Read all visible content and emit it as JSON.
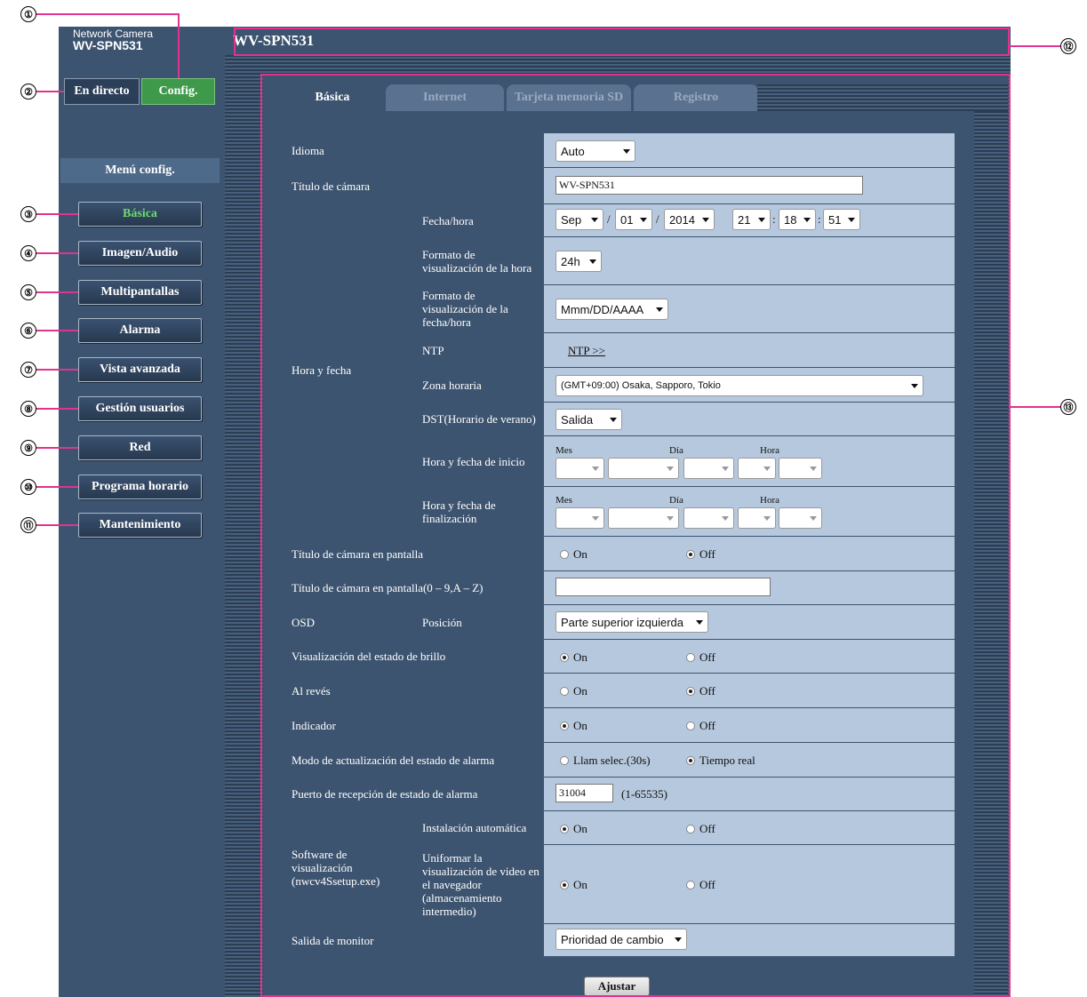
{
  "camera": {
    "label": "Network Camera",
    "model": "WV-SPN531"
  },
  "top_buttons": {
    "live": "En directo",
    "config": "Config."
  },
  "header": {
    "title": "WV-SPN531"
  },
  "menu": {
    "title": "Menú config.",
    "items": [
      "Básica",
      "Imagen/Audio",
      "Multipantallas",
      "Alarma",
      "Vista avanzada",
      "Gestión usuarios",
      "Red",
      "Programa horario",
      "Mantenimiento"
    ]
  },
  "tabs": [
    "Básica",
    "Internet",
    "Tarjeta memoria SD",
    "Registro"
  ],
  "form": {
    "idioma": {
      "label": "Idioma",
      "value": "Auto"
    },
    "titulo_camara": {
      "label": "Título de cámara",
      "value": "WV-SPN531"
    },
    "hora_fecha": {
      "label": "Hora y fecha",
      "fecha_hora": {
        "label": "Fecha/hora",
        "month": "Sep",
        "day": "01",
        "year": "2014",
        "hour": "21",
        "minute": "18",
        "second": "51",
        "sep_date": "/",
        "sep_time": ":"
      },
      "formato_hora": {
        "label": "Formato de visualización de la hora",
        "value": "24h"
      },
      "formato_fecha": {
        "label": "Formato de visualización de la fecha/hora",
        "value": "Mmm/DD/AAAA"
      },
      "ntp": {
        "label": "NTP",
        "link": "NTP >>"
      },
      "zona": {
        "label": "Zona horaria",
        "value": "(GMT+09:00) Osaka, Sapporo, Tokio"
      },
      "dst": {
        "label": "DST(Horario de verano)",
        "value": "Salida"
      },
      "inicio": {
        "label": "Hora y fecha de inicio"
      },
      "fin": {
        "label": "Hora y fecha de finalización"
      },
      "col_mes": "Mes",
      "col_dia": "Día",
      "col_hora": "Hora"
    },
    "titulo_pantalla": {
      "label": "Título de cámara en pantalla",
      "on": "On",
      "off": "Off",
      "selected": "Off"
    },
    "titulo_pantalla_09": {
      "label": "Título de cámara en pantalla(0 – 9,A – Z)",
      "value": ""
    },
    "osd": {
      "label": "OSD",
      "sub": "Posición",
      "value": "Parte superior izquierda"
    },
    "brillo": {
      "label": "Visualización del estado de brillo",
      "on": "On",
      "off": "Off",
      "selected": "On"
    },
    "alreves": {
      "label": "Al revés",
      "on": "On",
      "off": "Off",
      "selected": "Off"
    },
    "indicador": {
      "label": "Indicador",
      "on": "On",
      "off": "Off",
      "selected": "On"
    },
    "modo_alarma": {
      "label": "Modo de actualización del estado de alarma",
      "opt1": "Llam selec.(30s)",
      "opt2": "Tiempo real",
      "selected": "Tiempo real"
    },
    "puerto_alarma": {
      "label": "Puerto de recepción de estado de alarma",
      "value": "31004",
      "range": "(1-65535)"
    },
    "software": {
      "label": "Software de visualización (nwcv4Ssetup.exe)",
      "instalacion": {
        "label": "Instalación automática",
        "on": "On",
        "off": "Off",
        "selected": "On"
      },
      "uniformar": {
        "label": "Uniformar la visualización de video en el navegador (almacenamiento intermedio)",
        "on": "On",
        "off": "Off",
        "selected": "On"
      }
    },
    "salida_monitor": {
      "label": "Salida de monitor",
      "value": "Prioridad de cambio"
    }
  },
  "buttons": {
    "ajustar": "Ajustar"
  },
  "callouts": [
    "①",
    "②",
    "③",
    "④",
    "⑤",
    "⑥",
    "⑦",
    "⑧",
    "⑨",
    "⑩",
    "⑪",
    "⑫",
    "⑬"
  ],
  "colors": {
    "nav_bg": "#3d5470",
    "form_cell": "#b6c8dd",
    "config_green": "#3e9a4a",
    "active_menu_text": "#6ddc6b",
    "callout_line": "#e0338e"
  }
}
